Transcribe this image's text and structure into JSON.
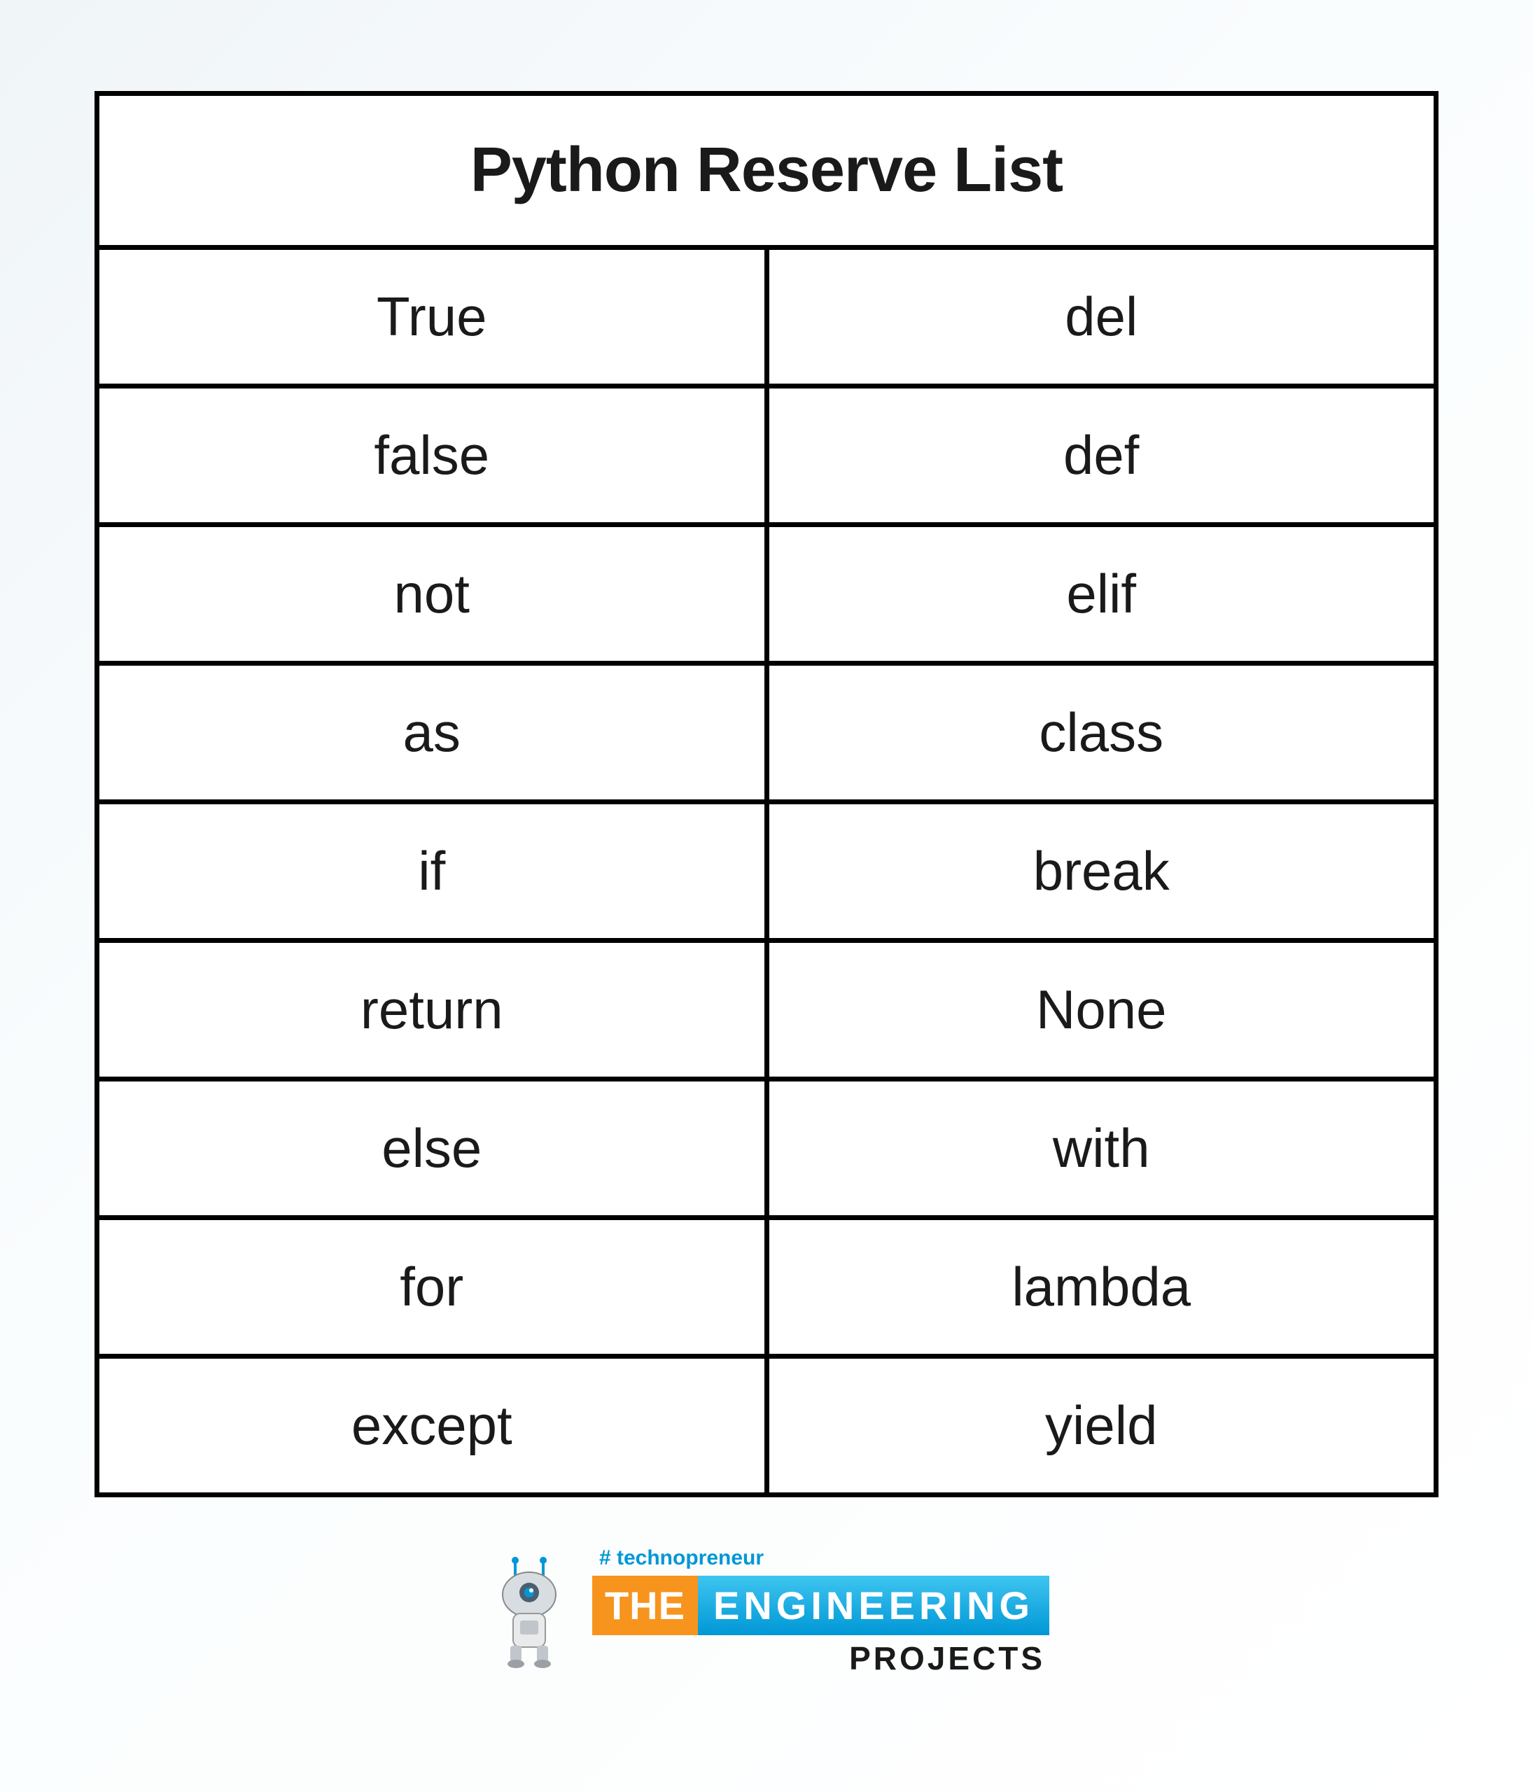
{
  "table": {
    "title": "Python Reserve List",
    "rows": [
      {
        "left": "True",
        "right": "del"
      },
      {
        "left": "false",
        "right": "def"
      },
      {
        "left": "not",
        "right": "elif"
      },
      {
        "left": "as",
        "right": "class"
      },
      {
        "left": "if",
        "right": "break"
      },
      {
        "left": "return",
        "right": "None"
      },
      {
        "left": "else",
        "right": "with"
      },
      {
        "left": "for",
        "right": "lambda"
      },
      {
        "left": "except",
        "right": "yield"
      }
    ]
  },
  "footer": {
    "hashtag": "# technopreneur",
    "brand_the": "THE",
    "brand_engineering": "ENGINEERING",
    "brand_projects": "PROJECTS"
  }
}
